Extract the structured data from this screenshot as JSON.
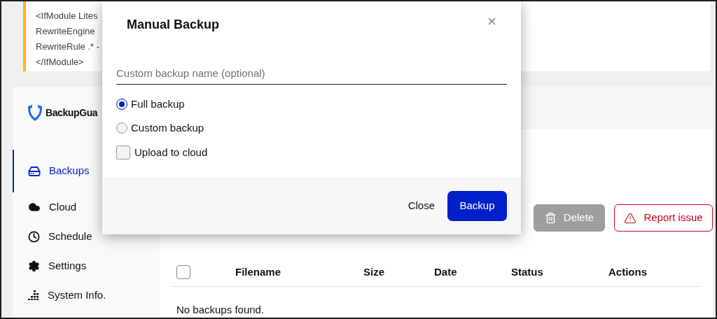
{
  "notice": {
    "lines": [
      "<IfModule Lites",
      "RewriteEngine",
      "RewriteRule .* -",
      "</IfModule>"
    ]
  },
  "brand": {
    "name": "BackupGua"
  },
  "sidebar": {
    "items": [
      {
        "label": "Backups",
        "kind": "drive",
        "selected": true
      },
      {
        "label": "Cloud",
        "kind": "cloud",
        "selected": false
      },
      {
        "label": "Schedule",
        "kind": "clock",
        "selected": false
      },
      {
        "label": "Settings",
        "kind": "gear",
        "selected": false
      },
      {
        "label": "System Info.",
        "kind": "bars",
        "selected": false
      }
    ]
  },
  "toolbar": {
    "buttons": [
      {
        "label": "Delete",
        "kind": "delete",
        "disabled": true
      },
      {
        "label": "Report issue",
        "kind": "report",
        "disabled": false
      }
    ]
  },
  "table": {
    "select_all": {
      "checked": false
    },
    "columns": [
      "Filename",
      "Size",
      "Date",
      "Status",
      "Actions"
    ],
    "empty_message": "No backups found."
  },
  "dialog": {
    "title": "Manual Backup",
    "name_field": {
      "placeholder": "Custom backup name (optional)"
    },
    "options": [
      {
        "kind": "radio",
        "label": "Full backup",
        "selected": true
      },
      {
        "kind": "radio",
        "label": "Custom backup",
        "selected": false
      },
      {
        "kind": "checkbox",
        "label": "Upload to cloud",
        "checked": false
      }
    ],
    "buttons": [
      {
        "label": "Close",
        "kind": "text"
      },
      {
        "label": "Backup",
        "kind": "primary"
      }
    ]
  }
}
